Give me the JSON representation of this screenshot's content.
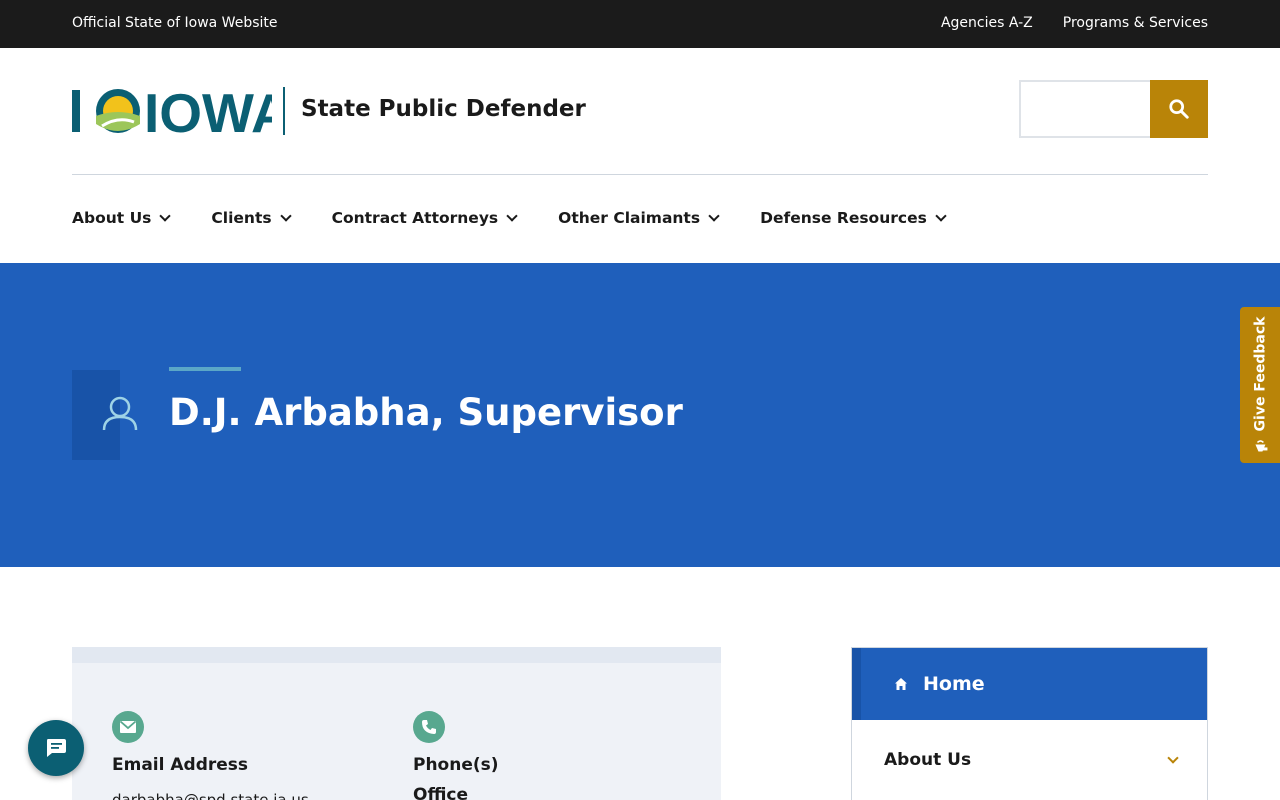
{
  "topbar": {
    "official_label": "Official State of Iowa Website",
    "links": [
      "Agencies A-Z",
      "Programs & Services"
    ]
  },
  "header": {
    "logo_text": "IOWA",
    "site_name": "State Public Defender",
    "search": {
      "placeholder": "",
      "button_icon": "search-icon"
    }
  },
  "nav": {
    "items": [
      "About Us",
      "Clients",
      "Contract Attorneys",
      "Other Claimants",
      "Defense Resources"
    ]
  },
  "hero": {
    "icon": "person-icon",
    "title": "D.J. Arbabha, Supervisor"
  },
  "feedback": {
    "label": "Give Feedback",
    "icon": "megaphone-icon"
  },
  "contact": {
    "email_label": "Email Address",
    "email_value": "darbabha@spd.state.ia.us",
    "phone_label": "Phone(s)",
    "phone_sublabel": "Office"
  },
  "sidenav": {
    "home_label": "Home",
    "items": [
      "About Us"
    ]
  },
  "colors": {
    "topbar": "#1b1b1b",
    "hero_blue": "#1f5fbb",
    "gold": "#b98408",
    "teal": "#0b5f73",
    "green_icon": "#58a88f"
  }
}
